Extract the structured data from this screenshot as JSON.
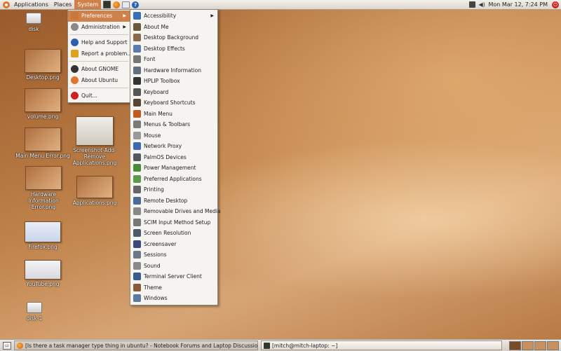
{
  "top_panel": {
    "menus": [
      "Applications",
      "Places",
      "System"
    ],
    "clock": "Mon Mar 12,  7:24 PM",
    "launchers": [
      "terminal-icon",
      "firefox-icon",
      "mail-icon",
      "help-icon"
    ]
  },
  "system_menu": {
    "items": [
      {
        "label": "Preferences",
        "icon": "preferences-icon",
        "submenu": true
      },
      {
        "label": "Administration",
        "icon": "administration-icon",
        "submenu": true
      },
      {
        "label": "Help and Support",
        "icon": "help-icon"
      },
      {
        "label": "Report a problem...",
        "icon": "bug-icon"
      },
      {
        "label": "About GNOME",
        "icon": "gnome-foot-icon"
      },
      {
        "label": "About Ubuntu",
        "icon": "ubuntu-icon"
      },
      {
        "label": "Quit...",
        "icon": "quit-icon"
      }
    ]
  },
  "preferences_menu": {
    "items": [
      {
        "label": "Accessibility",
        "color": "#3a6fb8",
        "submenu": true
      },
      {
        "label": "About Me",
        "color": "#6a5a3a"
      },
      {
        "label": "Desktop Background",
        "color": "#8a6a4a"
      },
      {
        "label": "Desktop Effects",
        "color": "#5a7ab0"
      },
      {
        "label": "Font",
        "color": "#777777"
      },
      {
        "label": "Hardware Information",
        "color": "#607080"
      },
      {
        "label": "HPLIP Toolbox",
        "color": "#333333"
      },
      {
        "label": "Keyboard",
        "color": "#555555"
      },
      {
        "label": "Keyboard Shortcuts",
        "color": "#554433"
      },
      {
        "label": "Main Menu",
        "color": "#c05a20"
      },
      {
        "label": "Menus & Toolbars",
        "color": "#7a7a7a"
      },
      {
        "label": "Mouse",
        "color": "#999999"
      },
      {
        "label": "Network Proxy",
        "color": "#3d6ab0"
      },
      {
        "label": "PalmOS Devices",
        "color": "#505a60"
      },
      {
        "label": "Power Management",
        "color": "#4a8a3a"
      },
      {
        "label": "Preferred Applications",
        "color": "#5a9a4a"
      },
      {
        "label": "Printing",
        "color": "#666666"
      },
      {
        "label": "Remote Desktop",
        "color": "#4a6a9a"
      },
      {
        "label": "Removable Drives and Media",
        "color": "#888888"
      },
      {
        "label": "SCIM Input Method Setup",
        "color": "#777777"
      },
      {
        "label": "Screen Resolution",
        "color": "#4a5a6a"
      },
      {
        "label": "Screensaver",
        "color": "#3a4a7a"
      },
      {
        "label": "Sessions",
        "color": "#6a7a8a"
      },
      {
        "label": "Sound",
        "color": "#8a8a8a"
      },
      {
        "label": "Terminal Server Client",
        "color": "#3a5a8a"
      },
      {
        "label": "Theme",
        "color": "#8a5a3a"
      },
      {
        "label": "Windows",
        "color": "#5a7aa0"
      }
    ]
  },
  "desktop_icons": [
    {
      "label": "disk",
      "kind": "drive"
    },
    {
      "label": "Desktop.png",
      "kind": "image"
    },
    {
      "label": "volume.png",
      "kind": "image"
    },
    {
      "label": "Main Menu Error.png",
      "kind": "image"
    },
    {
      "label": "Hardware Information Error.png",
      "kind": "image"
    },
    {
      "label": "Firefox.png",
      "kind": "image"
    },
    {
      "label": "YouTube.png",
      "kind": "image"
    },
    {
      "label": "disk-1",
      "kind": "drive"
    },
    {
      "label": "Screenshot-Add-Remove Applications.png",
      "kind": "image"
    },
    {
      "label": "Applications.png",
      "kind": "image"
    }
  ],
  "taskbar": {
    "tasks": [
      {
        "label": "[Is there a task manager type thing in ubuntu? - Notebook Forums and Laptop Discussion -...",
        "icon": "firefox-icon"
      },
      {
        "label": "[mitch@mitch-laptop: ~]",
        "icon": "terminal-icon"
      }
    ]
  }
}
